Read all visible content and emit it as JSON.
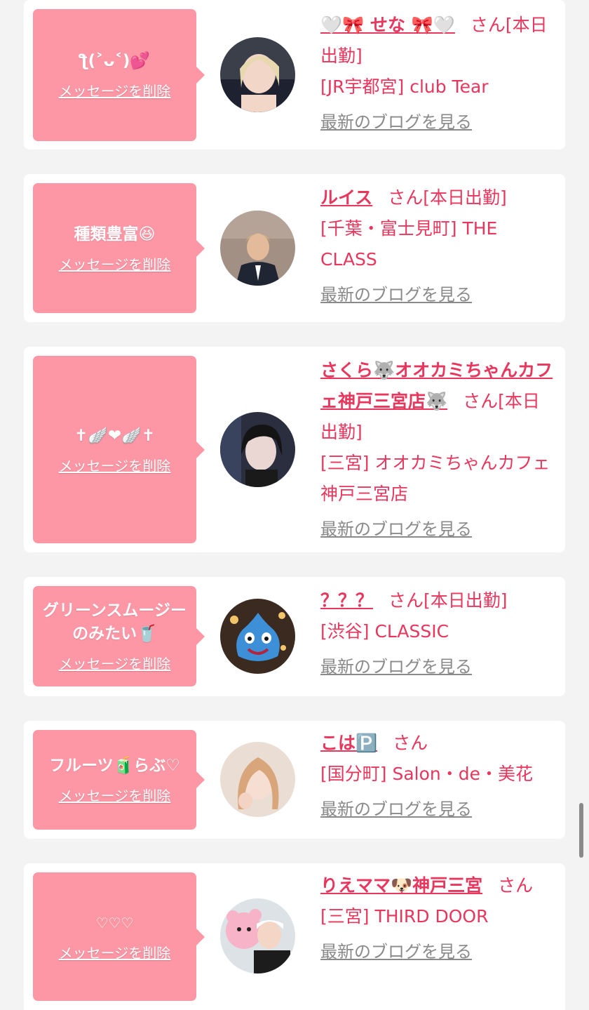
{
  "delete_label": "メッセージを削除",
  "blog_label": "最新のブログを見る",
  "accent_color": "#e8365d",
  "bubble_color": "#fd97a5",
  "cards": [
    {
      "message": "ƪ(˃ᴗ˂)💕",
      "name": "🤍🎀 せな 🎀🤍",
      "suffix": "さん[本日出勤]",
      "shop": "[JR宇都宮] club Tear"
    },
    {
      "message": "種類豊富😆",
      "name": "ルイス",
      "suffix": "さん[本日出勤]",
      "shop": "[千葉・富士見町] THE CLASS"
    },
    {
      "message": "✝︎🪽❤🪽✝︎",
      "name": "さくら🐺オオカミちゃんカフェ神戸三宮店🐺",
      "suffix": "さん[本日出勤]",
      "shop": "[三宮] オオカミちゃんカフェ神戸三宮店"
    },
    {
      "message": "グリーンスムージーのみたい🥤",
      "name": "？？？",
      "suffix": "さん[本日出勤]",
      "shop": "[渋谷] CLASSIC"
    },
    {
      "message": "フルーツ🧃らぶ♡",
      "name": "こは🅿️",
      "suffix": "さん",
      "shop": "[国分町] Salon・de・美花"
    },
    {
      "message": "♡♡♡",
      "name": "りえママ🐶神戸三宮",
      "suffix": "さん",
      "shop": "[三宮] THIRD DOOR"
    }
  ]
}
